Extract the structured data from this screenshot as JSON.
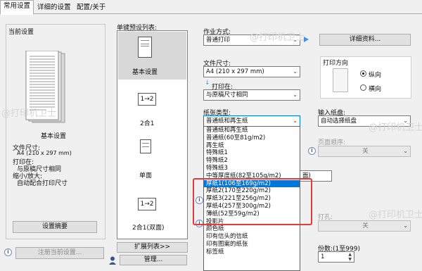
{
  "tabs": [
    "常用设置",
    "详细的设置",
    "配置/关于"
  ],
  "current_settings": {
    "title": "当前设置",
    "preview_label": "基本设置",
    "details": [
      "文件尺寸:",
      "A4 (210 x 297 mm)",
      "打印在:",
      "与原稿尺寸相同",
      "缩小/放大:",
      "自动配合打印尺寸"
    ],
    "summary_button": "设置摘要",
    "register_button": "注册当前设置..."
  },
  "presets": {
    "title": "单键预设列表:",
    "items": [
      "基本设置",
      "2合1",
      "单面",
      "2合1(双面)"
    ],
    "expand_button": "扩展列表>>",
    "manage_button": "管理..."
  },
  "job": {
    "mode_label": "作业方式:",
    "mode_value": "普通打印",
    "details_button": "详细资料...",
    "size_label": "文件尺寸:",
    "size_value": "A4 (210 x 297 mm)",
    "print_on_label": "打印在:",
    "print_on_value": "与原稿尺寸相同",
    "paper_type_label": "纸张类型:",
    "paper_type_value": "普通纸和再生纸"
  },
  "orientation": {
    "title": "打印方向",
    "options": [
      "纵向",
      "横向"
    ]
  },
  "input_tray": {
    "label": "输入纸盘:",
    "value": "自动选择纸盘"
  },
  "right_controls": {
    "page_order_label": "页面顺序:",
    "page_order_value": "关",
    "partial_select_value": "面)",
    "punch_label": "打孔:",
    "punch_value": "关",
    "copies_label": "份数:(1至999)",
    "copies_value": "1"
  },
  "paper_type_options": [
    "普通纸和再生纸",
    "普通纸(60至81g/m2)",
    "再生纸",
    "特殊纸1",
    "特殊纸2",
    "特殊纸3",
    "中等厚度纸(82至105g/m2)",
    "厚纸1(106至169g/m2)",
    "厚纸2(170至220g/m2)",
    "厚纸3(221至256g/m2)",
    "厚纸4(257至300g/m2)",
    "薄纸(52至59g/m2)",
    "投影片",
    "颜色纸",
    "印有信头的信纸",
    "印有图案的纸张",
    "标签纸"
  ],
  "selected_paper_index": 7,
  "watermark": "@打印机卫士"
}
